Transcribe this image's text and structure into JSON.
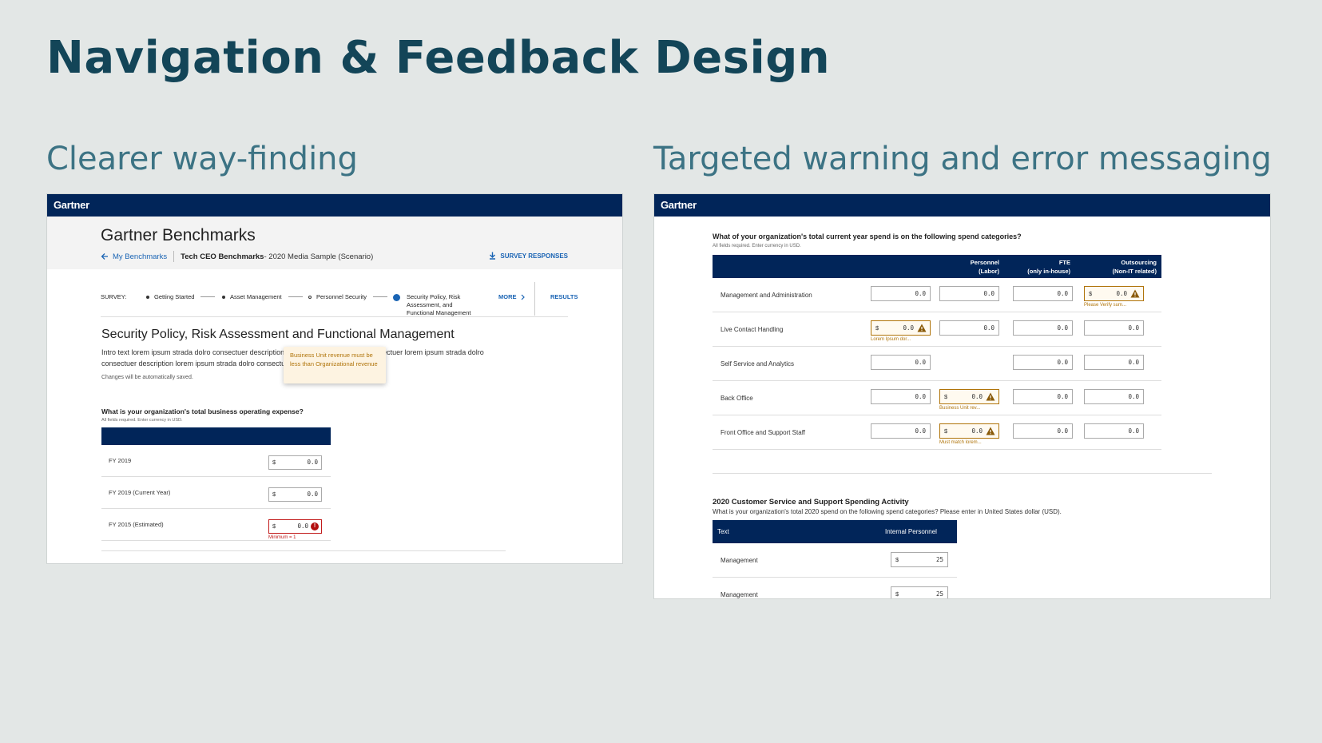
{
  "slide": {
    "title": "Navigation & Feedback Design",
    "left_heading": "Clearer way-finding",
    "right_heading": "Targeted warning and error messaging"
  },
  "brand": "Gartner",
  "left": {
    "page_title": "Gartner Benchmarks",
    "back_link": "My Benchmarks",
    "crumb_bold": "Tech CEO Benchmarks",
    "crumb_rest": " - 2020 Media Sample (Scenario)",
    "survey_responses": "SURVEY RESPONSES",
    "survey_label": "SURVEY:",
    "steps": [
      "Getting Started",
      "Asset Management",
      "Personnel Security",
      "Security Policy, Risk Assessment, and Functional Management"
    ],
    "more": "MORE",
    "results": "RESULTS",
    "section_title": "Security Policy, Risk Assessment and Functional Management",
    "intro": "Intro text lorem ipsum strada dolro consectuer description lorem ipsum strada dolro consectuer  lorem ipsum strada dolro consectuer description lorem ipsum strada dolro consectuer.",
    "info_icon": "i",
    "saved_note": "Changes will be automatically saved.",
    "question": "What is your organization's total business operating expense?",
    "required_note": "All fields required. Enter currency in USD.",
    "currency": "$",
    "rows": [
      {
        "label": "FY 2019",
        "value": "0.0"
      },
      {
        "label": "FY 2019 (Current Year)",
        "value": "0.0"
      },
      {
        "label": "FY 2015 (Estimated)",
        "value": "0.0"
      }
    ],
    "error_icon": "!",
    "error_message": "Minimum = 1"
  },
  "right": {
    "question": "What of your organization's total current year spend is on the following spend categories?",
    "required_note": "All fields required. Enter currency in USD.",
    "headers": [
      {
        "line1": "Personnel",
        "line2": "(Labor)"
      },
      {
        "line1": "FTE",
        "line2": "(only in-house)"
      },
      {
        "line1": "Outsourcing",
        "line2": "(Non-IT related)"
      }
    ],
    "currency": "$",
    "rows": [
      {
        "label": "Management and Administration",
        "values": [
          "0.0",
          "0.0",
          "0.0",
          "0.0"
        ]
      },
      {
        "label": "Live Contact Handling",
        "values": [
          "0.0",
          "0.0",
          "0.0",
          "0.0"
        ]
      },
      {
        "label": "Self Service and Analytics",
        "values": [
          "0.0",
          "",
          "0.0",
          "0.0"
        ]
      },
      {
        "label": "Back Office",
        "values": [
          "0.0",
          "0.0",
          "0.0",
          "0.0"
        ]
      },
      {
        "label": "Front Office and Support Staff",
        "values": [
          "0.0",
          "0.0",
          "0.0",
          "0.0"
        ]
      }
    ],
    "warnings": {
      "r0c3": "Please Verify sum...",
      "r1c0": "Lorem Ipsum dor...",
      "r3c1": "Business Unit rev...",
      "r4c1": "Must match lorem..."
    },
    "tooltip": "Business Unit revenue must be less than Organizational revenue",
    "section2_title": "2020 Customer Service and Support Spending Activity",
    "section2_sub": "What is your organization's total 2020 spend on the following spend categories? Please enter in United States dollar (USD).",
    "table2_headers": [
      "Text",
      "Internal Personnel"
    ],
    "table2_rows": [
      {
        "label": "Management",
        "value": "25"
      },
      {
        "label": "Management",
        "value": "25"
      }
    ]
  },
  "colors": {
    "navy": "#012559",
    "title": "#134558",
    "heading": "#3c7384",
    "link": "#1a64b4",
    "error": "#c21b1b",
    "warning": "#b0740a",
    "background": "#e3e7e6"
  },
  "icons": [
    "arrow-left-icon",
    "download-icon",
    "chevron-right-icon",
    "info-icon",
    "error-icon",
    "warning-icon"
  ]
}
